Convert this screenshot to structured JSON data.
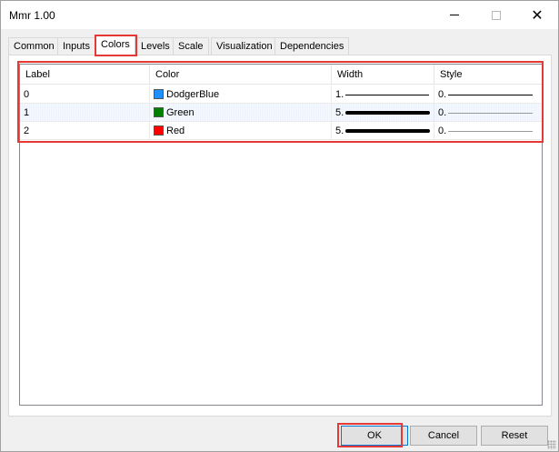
{
  "window": {
    "title": "Mmr 1.00"
  },
  "tabs": [
    {
      "label": "Common"
    },
    {
      "label": "Inputs"
    },
    {
      "label": "Colors"
    },
    {
      "label": "Levels"
    },
    {
      "label": "Scale"
    },
    {
      "label": "Visualization"
    },
    {
      "label": "Dependencies"
    }
  ],
  "active_tab": "Colors",
  "table": {
    "headers": {
      "label": "Label",
      "color": "Color",
      "width": "Width",
      "style": "Style"
    },
    "rows": [
      {
        "label": "0",
        "color_name": "DodgerBlue",
        "color_hex": "#1e90ff",
        "width": "1.",
        "style": "0."
      },
      {
        "label": "1",
        "color_name": "Green",
        "color_hex": "#008000",
        "width": "5.",
        "style": "0."
      },
      {
        "label": "2",
        "color_name": "Red",
        "color_hex": "#ff0000",
        "width": "5.",
        "style": "0."
      }
    ]
  },
  "buttons": {
    "ok": "OK",
    "cancel": "Cancel",
    "reset": "Reset"
  },
  "accent_colors": {
    "highlight": "#e53935"
  }
}
